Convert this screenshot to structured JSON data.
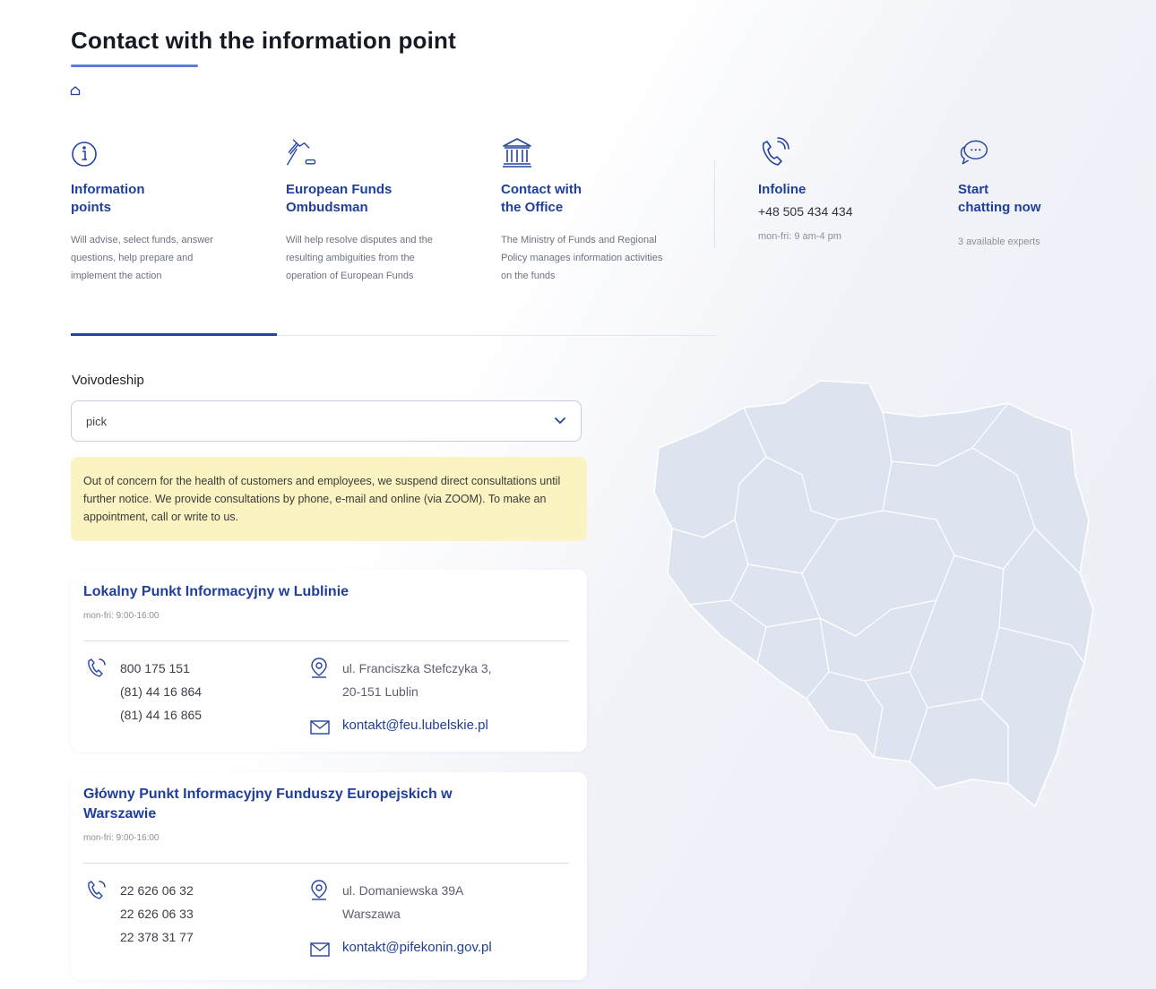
{
  "page": {
    "title": "Contact with the information point"
  },
  "categories": [
    {
      "id": "information-points",
      "title": "Information\npoints",
      "desc": "Will advise, select funds, answer questions, help prepare and implement the action",
      "icon": "info-icon"
    },
    {
      "id": "ombudsman",
      "title": "European Funds\nOmbudsman",
      "desc": "Will help resolve disputes and the resulting ambiguities from the operation of European Funds",
      "icon": "gavel-icon"
    },
    {
      "id": "office",
      "title": "Contact with\nthe Office",
      "desc": "The Ministry of Funds and Regional Policy manages information activities on the funds",
      "icon": "building-icon"
    },
    {
      "id": "infoline",
      "title": "Infoline",
      "phone": "+48 505 434 434",
      "hours": "mon-fri: 9 am-4 pm",
      "icon": "phone-icon"
    },
    {
      "id": "chat",
      "title": "Start\nchatting now",
      "experts": "3 available experts",
      "icon": "chat-icon"
    }
  ],
  "filter": {
    "label": "Voivodeship",
    "value": "pick"
  },
  "notice": "Out of concern for the health of customers and employees, we suspend direct consultations until further notice. We provide consultations by phone, e-mail and online (via ZOOM). To make an appointment, call or write to us.",
  "points": [
    {
      "name": "Lokalny Punkt Informacyjny w Lublinie",
      "hours": "mon-fri: 9:00-16:00",
      "phones": [
        "800 175 151",
        "(81) 44 16 864",
        "(81) 44 16 865"
      ],
      "address": [
        "ul. Franciszka Stefczyka 3,",
        "20-151 Lublin"
      ],
      "email": "kontakt@feu.lubelskie.pl"
    },
    {
      "name": "Główny Punkt Informacyjny Funduszy Europejskich w Warszawie",
      "hours": "mon-fri: 9:00-16:00",
      "phones": [
        "22 626 06 32",
        "22 626 06 33",
        "22 378 31 77"
      ],
      "address": [
        "ul. Domaniewska 39A",
        "Warszawa"
      ],
      "email": "kontakt@pifekonin.gov.pl"
    }
  ],
  "colors": {
    "accent": "#1f3f9a",
    "underline": "#5b7fd6",
    "notice_bg": "#fbf3c2",
    "map_fill": "#dde3ef"
  }
}
